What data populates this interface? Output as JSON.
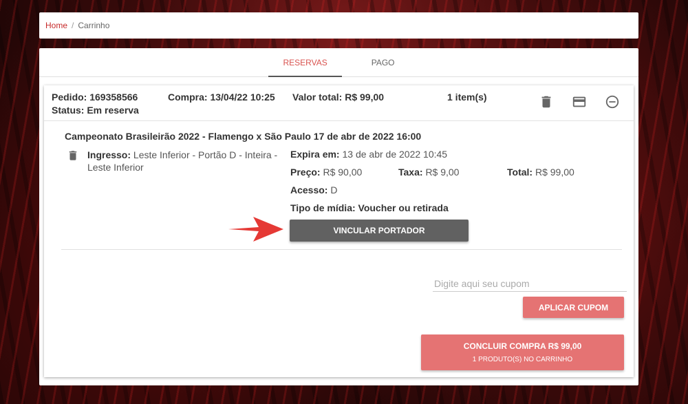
{
  "breadcrumb": {
    "home": "Home",
    "separator": "/",
    "current": "Carrinho"
  },
  "tabs": [
    {
      "label": "RESERVAS",
      "active": true
    },
    {
      "label": "PAGO",
      "active": false
    }
  ],
  "order": {
    "pedido": "Pedido: 169358566",
    "status": "Status: Em reserva",
    "compra": "Compra: 13/04/22 10:25",
    "valor_total": "Valor total: R$ 99,00",
    "items": "1 item(s)",
    "icons": [
      "trash-icon",
      "credit-card-icon",
      "minus-circle-icon"
    ]
  },
  "event": {
    "title": "Campeonato Brasileirão 2022 - Flamengo x São Paulo 17 de abr de 2022 16:00",
    "ingresso_label": "Ingresso:",
    "ingresso_value": "Leste Inferior - Portão D - Inteira - Leste Inferior",
    "expira_label": "Expira em:",
    "expira_value": "13 de abr de 2022 10:45",
    "preco_label": "Preço:",
    "preco_value": "R$ 90,00",
    "taxa_label": "Taxa:",
    "taxa_value": "R$ 9,00",
    "total_label": "Total:",
    "total_value": "R$ 99,00",
    "acesso_label": "Acesso:",
    "acesso_value": "D",
    "midia_label": "Tipo de mídia:",
    "midia_value": "Voucher ou retirada",
    "link_button": "VINCULAR PORTADOR"
  },
  "coupon": {
    "placeholder": "Digite aqui seu cupom",
    "value": "",
    "apply_button": "APLICAR CUPOM"
  },
  "checkout": {
    "main": "CONCLUIR COMPRA R$ 99,00",
    "sub": "1 PRODUTO(S) NO CARRINHO"
  },
  "colors": {
    "accent": "#c62828",
    "button_red": "#e57373",
    "button_dark": "#616161",
    "arrow": "#e53935"
  }
}
